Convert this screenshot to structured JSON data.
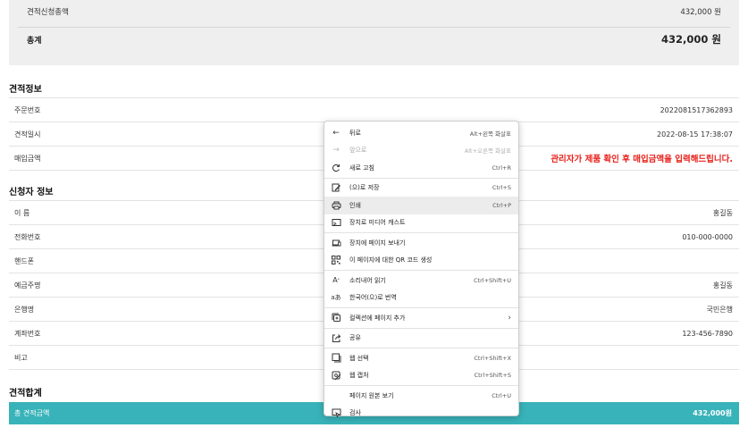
{
  "summary": {
    "request_total_label": "견적신청총액",
    "request_total_value": "432,000 원",
    "grand_total_label": "총계",
    "grand_total_value": "432,000 원"
  },
  "estimate_info": {
    "title": "견적정보",
    "rows": [
      {
        "label": "주문번호",
        "value": "2022081517362893"
      },
      {
        "label": "견적일시",
        "value": "2022-08-15 17:38:07"
      },
      {
        "label": "매입금액",
        "value": "관리자가 제품 확인 후 매입금액을 입력해드립니다."
      }
    ]
  },
  "applicant_info": {
    "title": "신청자 정보",
    "rows": [
      {
        "label": "이 름",
        "value": "홍길동"
      },
      {
        "label": "전화번호",
        "value": "010-000-0000"
      },
      {
        "label": "핸드폰",
        "value": ""
      },
      {
        "label": "예금주명",
        "value": "홍길동"
      },
      {
        "label": "은행명",
        "value": "국민은행"
      },
      {
        "label": "계좌번호",
        "value": "123-456-7890"
      },
      {
        "label": "비고",
        "value": ""
      }
    ]
  },
  "estimate_total": {
    "title": "견적합계",
    "label": "총 견적금액",
    "value": "432,000원"
  },
  "context_menu": {
    "items": [
      {
        "icon": "back-arrow-icon",
        "label": "뒤로",
        "shortcut": "Alt+왼쪽 화살표"
      },
      {
        "icon": "forward-arrow-icon",
        "label": "앞으로",
        "shortcut": "Alt+오른쪽 화살표"
      },
      {
        "icon": "refresh-icon",
        "label": "새로 고침",
        "shortcut": "Ctrl+R"
      },
      {
        "icon": "save-as-icon",
        "label": "(으)로 저장",
        "shortcut": "Ctrl+S"
      },
      {
        "icon": "print-icon",
        "label": "인쇄",
        "shortcut": "Ctrl+P"
      },
      {
        "icon": "cast-icon",
        "label": "장치로 미디어 캐스트",
        "shortcut": ""
      },
      {
        "icon": "send-to-device-icon",
        "label": "장치에 페이지 보내기",
        "shortcut": ""
      },
      {
        "icon": "qr-code-icon",
        "label": "이 페이지에 대한 QR 코드 생성",
        "shortcut": ""
      },
      {
        "icon": "read-aloud-icon",
        "label": "소리내어 읽기",
        "shortcut": "Ctrl+Shift+U"
      },
      {
        "icon": "translate-icon",
        "label": "한국어(으)로 번역",
        "shortcut": ""
      },
      {
        "icon": "collections-icon",
        "label": "컬렉션에 페이지 추가",
        "shortcut": ""
      },
      {
        "icon": "share-icon",
        "label": "공유",
        "shortcut": ""
      },
      {
        "icon": "web-select-icon",
        "label": "웹 선택",
        "shortcut": "Ctrl+Shift+X"
      },
      {
        "icon": "web-capture-icon",
        "label": "웹 캡처",
        "shortcut": "Ctrl+Shift+S"
      },
      {
        "icon": "",
        "label": "페이지 원본 보기",
        "shortcut": "Ctrl+U"
      },
      {
        "icon": "inspect-icon",
        "label": "검사",
        "shortcut": ""
      }
    ],
    "submenu_arrow": "›"
  },
  "colors": {
    "total_bar": "#38b3b9",
    "notice_red": "#e8201a",
    "summary_bg": "#efefef"
  }
}
